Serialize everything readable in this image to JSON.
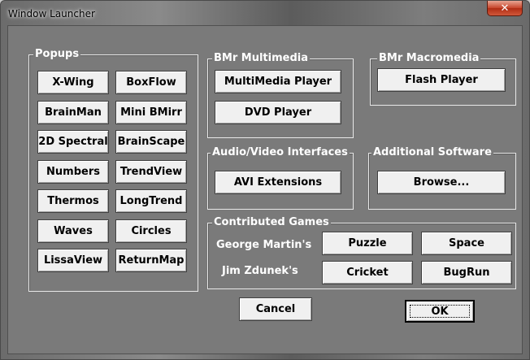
{
  "window": {
    "title": "Window Launcher",
    "close_symbol": "✕"
  },
  "popups": {
    "title": "Popups",
    "buttons": [
      "X-Wing",
      "BoxFlow",
      "BrainMan",
      "Mini BMirr",
      "2D Spectral",
      "BrainScape",
      "Numbers",
      "TrendView",
      "Thermos",
      "LongTrend",
      "Waves",
      "Circles",
      "LissaView",
      "ReturnMap"
    ]
  },
  "multimedia": {
    "title": "BMr Multimedia",
    "buttons": [
      "MultiMedia Player",
      "DVD Player"
    ]
  },
  "macromedia": {
    "title": "BMr Macromedia",
    "buttons": [
      "Flash Player"
    ]
  },
  "av": {
    "title": "Audio/Video Interfaces",
    "buttons": [
      "AVI Extensions"
    ]
  },
  "additional": {
    "title": "Additional Software",
    "buttons": [
      "Browse..."
    ]
  },
  "games": {
    "title": "Contributed Games",
    "authors": [
      "George Martin's",
      "Jim Zdunek's"
    ],
    "buttons": [
      "Puzzle",
      "Space",
      "Cricket",
      "BugRun"
    ]
  },
  "footer": {
    "cancel": "Cancel",
    "ok": "OK"
  }
}
